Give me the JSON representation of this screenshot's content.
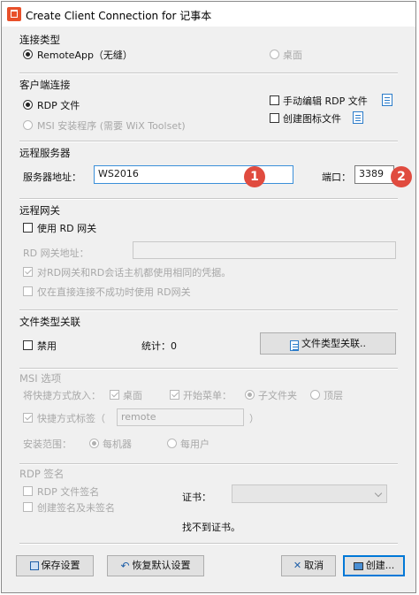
{
  "window": {
    "title": "Create Client Connection for 记事本"
  },
  "conn_type": {
    "heading": "连接类型",
    "remoteapp_label": "RemoteApp（无缝）",
    "desktop_label": "桌面"
  },
  "client": {
    "heading": "客户端连接",
    "rdp_file_label": "RDP 文件",
    "msi_label": "MSI 安装程序 (需要 WiX Toolset)",
    "manual_edit_label": "手动编辑 RDP 文件",
    "create_icon_label": "创建图标文件"
  },
  "remote_server": {
    "heading": "远程服务器",
    "address_label": "服务器地址：",
    "address_value": "WS2016",
    "port_label": "端口：",
    "port_value": "3389",
    "badge1": "1",
    "badge2": "2"
  },
  "gateway": {
    "heading": "远程网关",
    "use_rd_gateway": "使用 RD 网关",
    "address_label": "RD 网关地址：",
    "address_value": "",
    "same_credentials": "对RD网关和RD会话主机都使用相同的凭据。",
    "only_on_fail": "仅在直接连接不成功时使用 RD网关"
  },
  "file_assoc": {
    "heading": "文件类型关联",
    "disable_label": "禁用",
    "stats": "统计：0",
    "assoc_button": "文件类型关联.."
  },
  "msi": {
    "heading": "MSI 选项",
    "shortcut_put": "将快捷方式放入：",
    "desktop": "桌面",
    "start_menu": "开始菜单：",
    "subfolder": "子文件夹",
    "top_level": "顶层",
    "shortcut_tag": "快捷方式标签（",
    "tag_value": "remote",
    "tag_close": "）",
    "install_scope": "安装范围：",
    "per_machine": "每机器",
    "per_user": "每用户"
  },
  "rdp_sign": {
    "heading": "RDP 签名",
    "sign_rdp": "RDP 文件签名",
    "create_sign": "创建签名及未签名",
    "cert_label": "证书：",
    "no_cert": "找不到证书。"
  },
  "footer": {
    "save": "保存设置",
    "restore": "恢复默认设置",
    "cancel": "取消",
    "create": "创建..."
  },
  "colors": {
    "accent": "#0078d7",
    "badge": "#e04b3f"
  }
}
